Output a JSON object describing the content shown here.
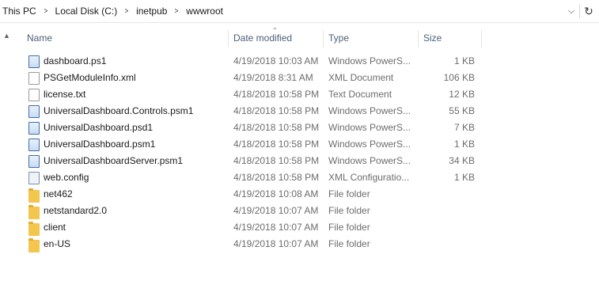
{
  "address": {
    "crumbs": [
      "This PC",
      "Local Disk (C:)",
      "inetpub",
      "wwwroot"
    ],
    "separator": ">",
    "dropdown_glyph": "⌵",
    "refresh_glyph": "↻"
  },
  "columns": {
    "name": "Name",
    "date": "Date modified",
    "type": "Type",
    "size": "Size"
  },
  "sort_glyph": "⌄",
  "scroll_glyph": "▲",
  "files": [
    {
      "name": "dashboard.ps1",
      "date": "4/19/2018 10:03 AM",
      "type": "Windows PowerS...",
      "size": "1 KB",
      "icon": "powershell-script-icon"
    },
    {
      "name": "PSGetModuleInfo.xml",
      "date": "4/19/2018 8:31 AM",
      "type": "XML Document",
      "size": "106 KB",
      "icon": "xml-file-icon"
    },
    {
      "name": "license.txt",
      "date": "4/18/2018 10:58 PM",
      "type": "Text Document",
      "size": "12 KB",
      "icon": "text-file-icon"
    },
    {
      "name": "UniversalDashboard.Controls.psm1",
      "date": "4/18/2018 10:58 PM",
      "type": "Windows PowerS...",
      "size": "55 KB",
      "icon": "powershell-module-icon"
    },
    {
      "name": "UniversalDashboard.psd1",
      "date": "4/18/2018 10:58 PM",
      "type": "Windows PowerS...",
      "size": "7 KB",
      "icon": "powershell-module-icon"
    },
    {
      "name": "UniversalDashboard.psm1",
      "date": "4/18/2018 10:58 PM",
      "type": "Windows PowerS...",
      "size": "1 KB",
      "icon": "powershell-module-icon"
    },
    {
      "name": "UniversalDashboardServer.psm1",
      "date": "4/18/2018 10:58 PM",
      "type": "Windows PowerS...",
      "size": "34 KB",
      "icon": "powershell-module-icon"
    },
    {
      "name": "web.config",
      "date": "4/18/2018 10:58 PM",
      "type": "XML Configuratio...",
      "size": "1 KB",
      "icon": "config-file-icon"
    },
    {
      "name": "net462",
      "date": "4/19/2018 10:08 AM",
      "type": "File folder",
      "size": "",
      "icon": "folder-icon"
    },
    {
      "name": "netstandard2.0",
      "date": "4/19/2018 10:07 AM",
      "type": "File folder",
      "size": "",
      "icon": "folder-icon"
    },
    {
      "name": "client",
      "date": "4/19/2018 10:07 AM",
      "type": "File folder",
      "size": "",
      "icon": "folder-icon"
    },
    {
      "name": "en-US",
      "date": "4/19/2018 10:07 AM",
      "type": "File folder",
      "size": "",
      "icon": "folder-icon"
    }
  ]
}
